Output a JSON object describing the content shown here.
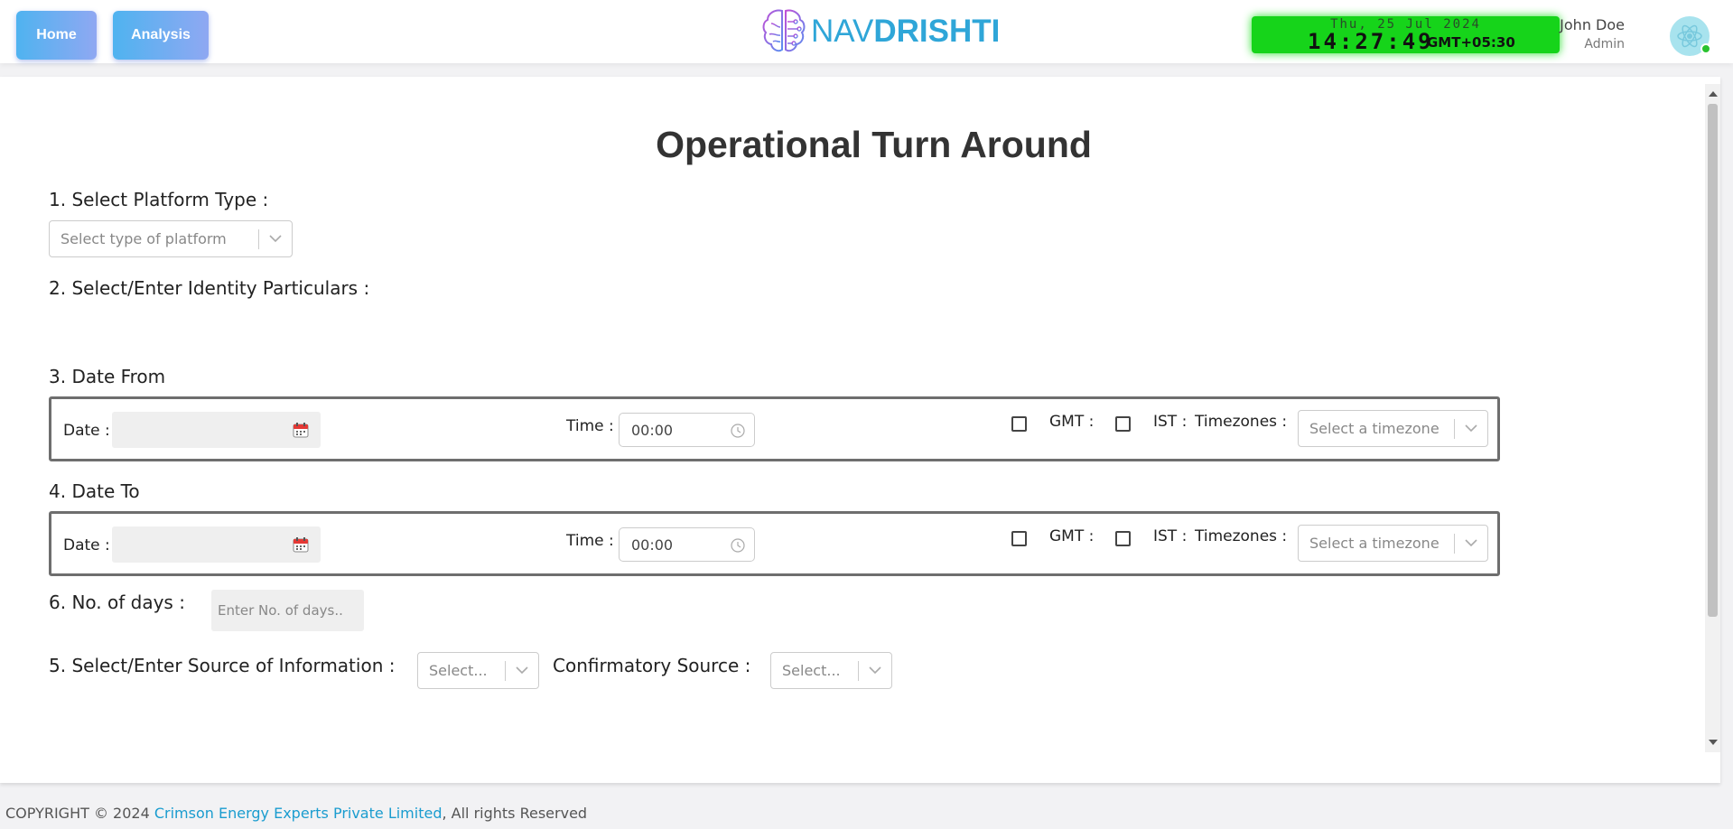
{
  "header": {
    "nav": {
      "home": "Home",
      "analysis": "Analysis"
    },
    "logo": {
      "part1": "NAV",
      "part2": "DRISHTI"
    },
    "clock": {
      "date": "Thu, 25 Jul 2024",
      "time": "14:27:49",
      "timezone": "GMT+05:30",
      "color": "#16d41a"
    },
    "user": {
      "name": "John Doe",
      "role": "Admin"
    }
  },
  "page": {
    "title": "Operational Turn Around",
    "platform": {
      "label": "1. Select Platform Type :",
      "placeholder": "Select type of platform"
    },
    "identity": {
      "label": "2. Select/Enter Identity Particulars :"
    },
    "date_from": {
      "label": "3. Date From",
      "date_label": "Date :",
      "time_label": "Time :",
      "time_value": "00:00",
      "gmt_label": "GMT :",
      "ist_label": "IST :",
      "tz_label": "Timezones :",
      "tz_placeholder": "Select a timezone"
    },
    "date_to": {
      "label": "4. Date To",
      "date_label": "Date :",
      "time_label": "Time :",
      "time_value": "00:00",
      "gmt_label": "GMT :",
      "ist_label": "IST :",
      "tz_label": "Timezones :",
      "tz_placeholder": "Select a timezone"
    },
    "days": {
      "label": "6. No. of days :",
      "placeholder": "Enter No. of days.."
    },
    "source": {
      "label": "5. Select/Enter Source of Information :",
      "placeholder": "Select...",
      "confirm_label": "Confirmatory Source :",
      "confirm_placeholder": "Select..."
    }
  },
  "footer": {
    "prefix": "COPYRIGHT © 2024 ",
    "company": "Crimson Energy Experts Private Limited",
    "suffix": ", All rights Reserved"
  }
}
